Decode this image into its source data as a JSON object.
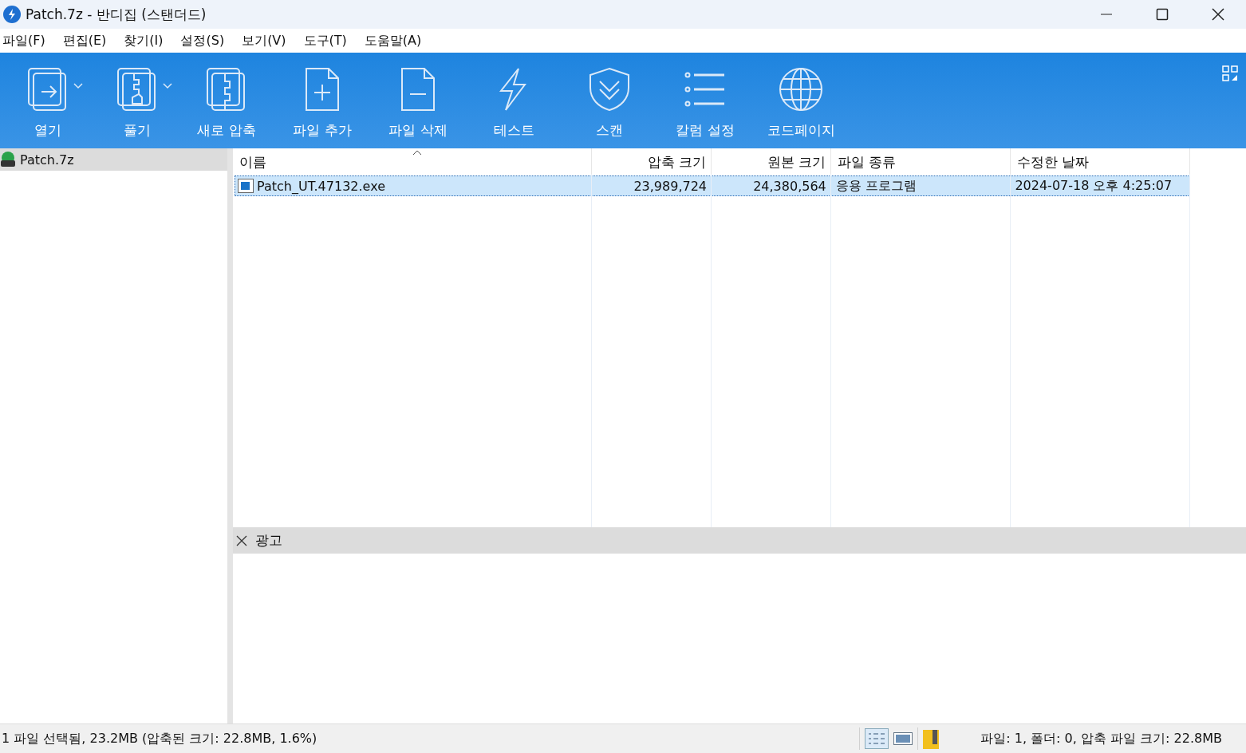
{
  "window": {
    "title": "Patch.7z - 반디집 (스탠더드)"
  },
  "menu": [
    "파일(F)",
    "편집(E)",
    "찾기(I)",
    "설정(S)",
    "보기(V)",
    "도구(T)",
    "도움말(A)"
  ],
  "toolbar": [
    {
      "label": "열기",
      "kind": "split"
    },
    {
      "label": "풀기",
      "kind": "split"
    },
    {
      "label": "새로 압축",
      "kind": "plain"
    },
    {
      "label": "파일 추가",
      "kind": "plain"
    },
    {
      "label": "파일 삭제",
      "kind": "plain"
    },
    {
      "label": "테스트",
      "kind": "plain"
    },
    {
      "label": "스캔",
      "kind": "plain"
    },
    {
      "label": "칼럼 설정",
      "kind": "plain"
    },
    {
      "label": "코드페이지",
      "kind": "plain"
    }
  ],
  "tree": [
    {
      "label": "Patch.7z",
      "selected": true
    }
  ],
  "table": {
    "columns": [
      {
        "label": "이름",
        "sorted": true
      },
      {
        "label": "압축 크기",
        "sorted": false
      },
      {
        "label": "원본 크기",
        "sorted": false
      },
      {
        "label": "파일 종류",
        "sorted": false
      },
      {
        "label": "수정한 날짜",
        "sorted": false
      }
    ],
    "rows": [
      {
        "selected": true,
        "cells": [
          "Patch_UT.47132.exe",
          "23,989,724",
          "24,380,564",
          "응용 프로그램",
          "2024-07-18 오후 4:25:07"
        ]
      }
    ]
  },
  "ad_panel": {
    "title": "광고"
  },
  "status_bar": {
    "left": "1 파일 선택됨, 23.2MB (압축된 크기: 22.8MB, 1.6%)",
    "right": "파일: 1, 폴더: 0, 압축 파일 크기: 22.8MB"
  }
}
